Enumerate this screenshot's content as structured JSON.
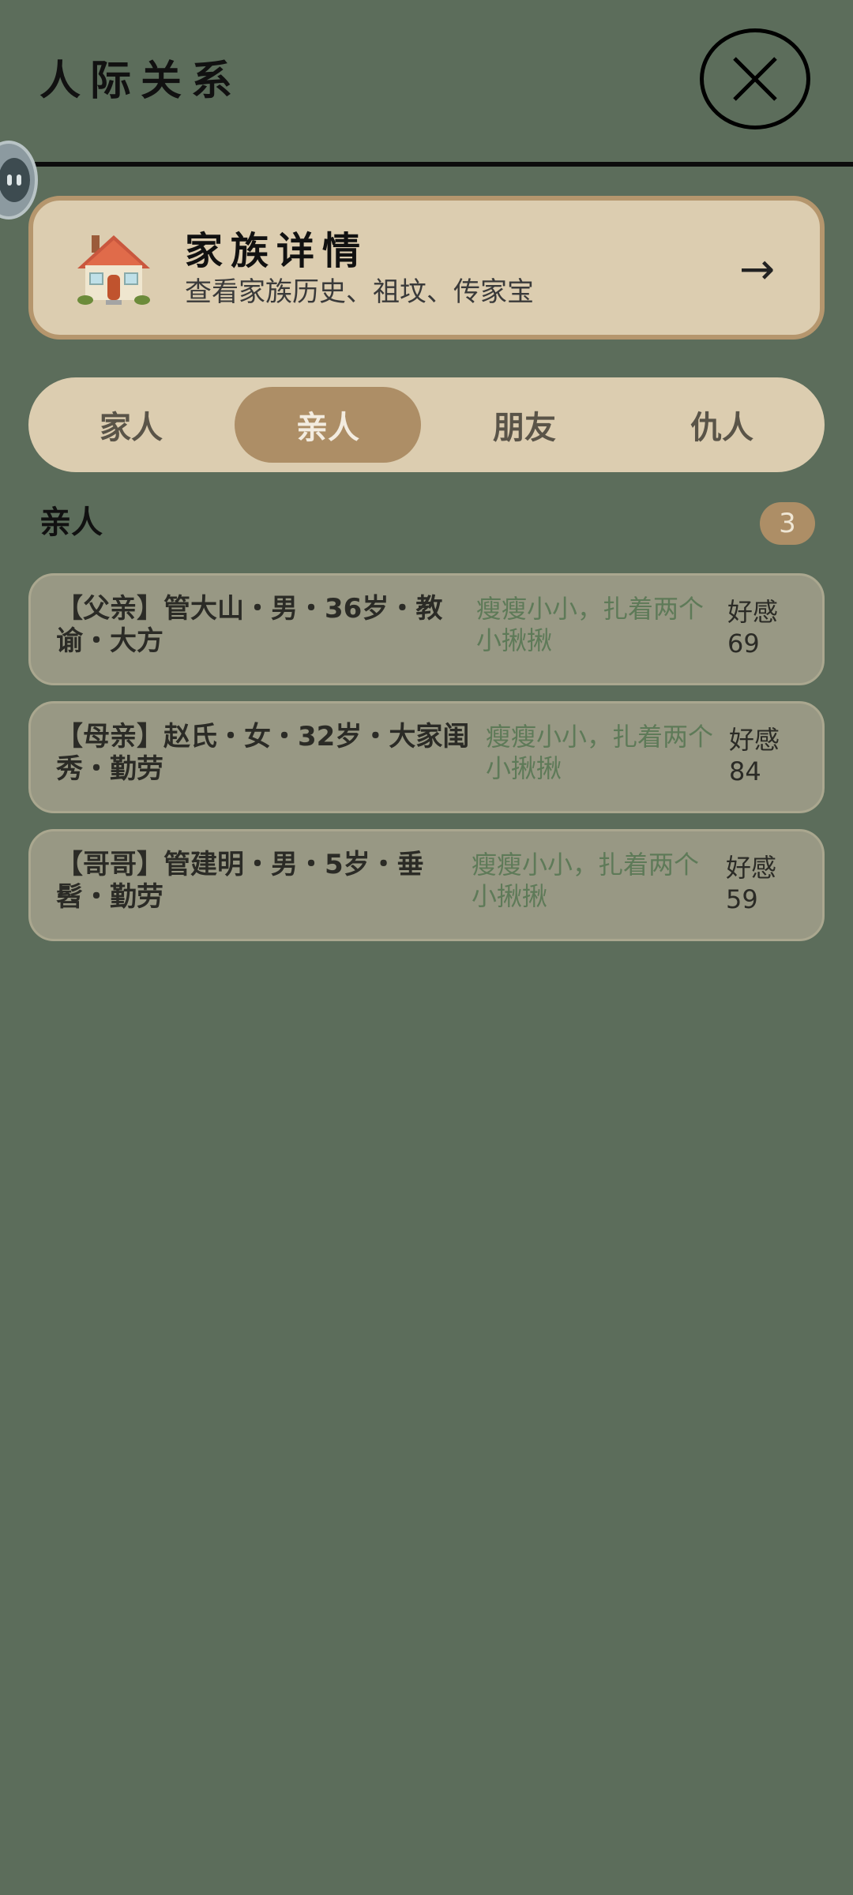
{
  "header": {
    "title": "人际关系",
    "close_icon": "close-icon"
  },
  "family_card": {
    "icon": "house-icon",
    "title": "家族详情",
    "subtitle": "查看家族历史、祖坟、传家宝",
    "arrow": "→"
  },
  "tabs": [
    {
      "label": "家人",
      "active": false
    },
    {
      "label": "亲人",
      "active": true
    },
    {
      "label": "朋友",
      "active": false
    },
    {
      "label": "仇人",
      "active": false
    }
  ],
  "section": {
    "title": "亲人",
    "count": "3"
  },
  "people": [
    {
      "main": "【父亲】管大山・男・36岁・教谕・大方",
      "desc": "瘦瘦小小，扎着两个小揪揪",
      "favor": "好感69"
    },
    {
      "main": "【母亲】赵氏・女・32岁・大家闺秀・勤劳",
      "desc": "瘦瘦小小，扎着两个小揪揪",
      "favor": "好感84"
    },
    {
      "main": "【哥哥】管建明・男・5岁・垂髫・勤劳",
      "desc": "瘦瘦小小，扎着两个小揪揪",
      "favor": "好感59"
    }
  ],
  "colors": {
    "background": "#5c6d5b",
    "card": "#dccdb0",
    "accent": "#ad8e66",
    "person_card": "#989884",
    "desc_text": "#5e7a58"
  }
}
